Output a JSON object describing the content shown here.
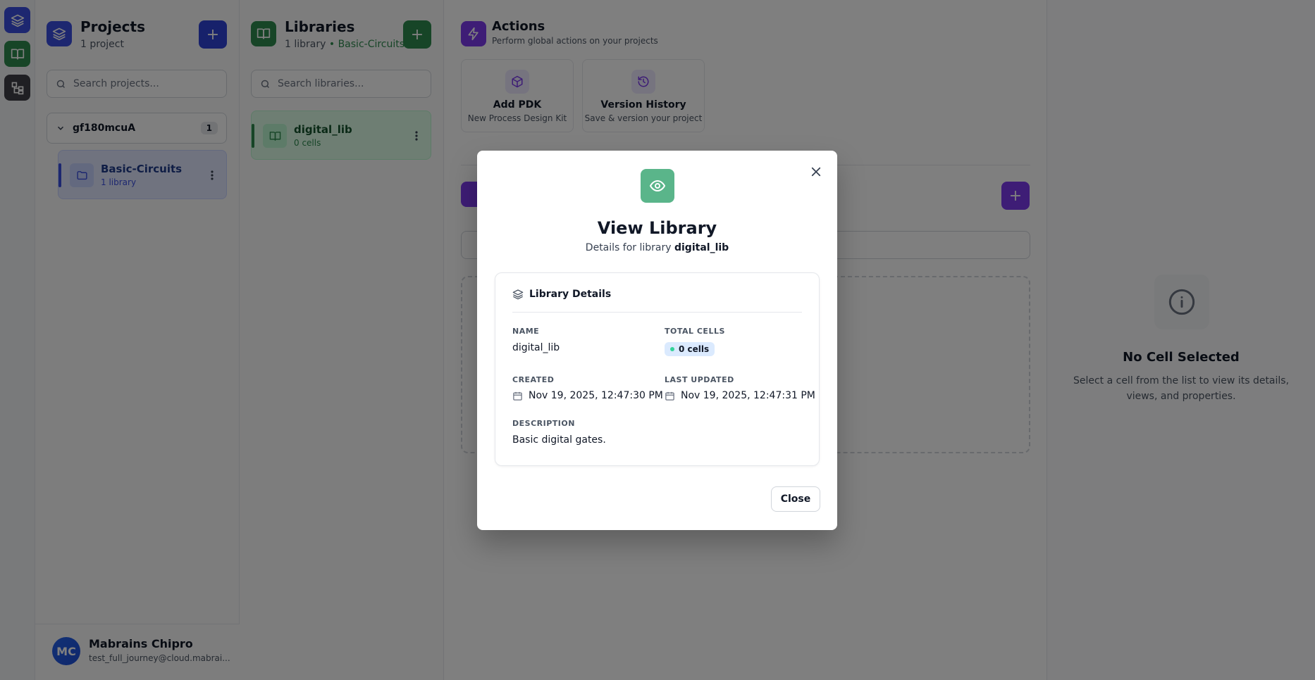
{
  "projects": {
    "title": "Projects",
    "subtitle": "1 project",
    "add_label": "+",
    "search_placeholder": "Search projects...",
    "group": {
      "name": "gf180mcuA",
      "count": "1"
    },
    "items": [
      {
        "title": "Basic-Circuits",
        "sub": "1 library"
      }
    ]
  },
  "libraries": {
    "title": "Libraries",
    "subtitle_count": "1 library",
    "subtitle_sep": " • ",
    "subtitle_project": "Basic-Circuits",
    "add_label": "+",
    "search_placeholder": "Search libraries...",
    "items": [
      {
        "title": "digital_lib",
        "sub": "0 cells"
      }
    ]
  },
  "actions": {
    "title": "Actions",
    "subtitle": "Perform global actions on your projects",
    "cards": [
      {
        "title": "Add PDK",
        "sub": "New Process Design Kit"
      },
      {
        "title": "Version History",
        "sub": "Save & version your project"
      }
    ]
  },
  "cells_panel": {
    "add_label": "+"
  },
  "right_panel": {
    "title": "No Cell Selected",
    "desc": "Select a cell from the list to view its details, views, and properties."
  },
  "user": {
    "initials": "MC",
    "name": "Mabrains Chipro",
    "email": "test_full_journey@cloud.mabrai..."
  },
  "modal": {
    "title": "View Library",
    "subtitle_prefix": "Details for library ",
    "subtitle_name": "digital_lib",
    "section_title": "Library Details",
    "name_label": "NAME",
    "name_value": "digital_lib",
    "cells_label": "TOTAL CELLS",
    "cells_value": "0 cells",
    "created_label": "CREATED",
    "created_value": "Nov 19, 2025, 12:47:30 PM",
    "updated_label": "LAST UPDATED",
    "updated_value": "Nov 19, 2025, 12:47:31 PM",
    "desc_label": "DESCRIPTION",
    "desc_value": "Basic digital gates.",
    "close_label": "Close"
  },
  "colors": {
    "projects_accent": "#2f43d6",
    "libraries_accent": "#2f8a4f",
    "actions_accent": "#7c3aed",
    "modal_icon": "#5ab58a"
  },
  "icons": {
    "rail": [
      "layers-icon",
      "book-icon",
      "hierarchy-icon"
    ],
    "modal": [
      "eye-icon",
      "close-icon",
      "layers-icon",
      "calendar-icon"
    ]
  }
}
